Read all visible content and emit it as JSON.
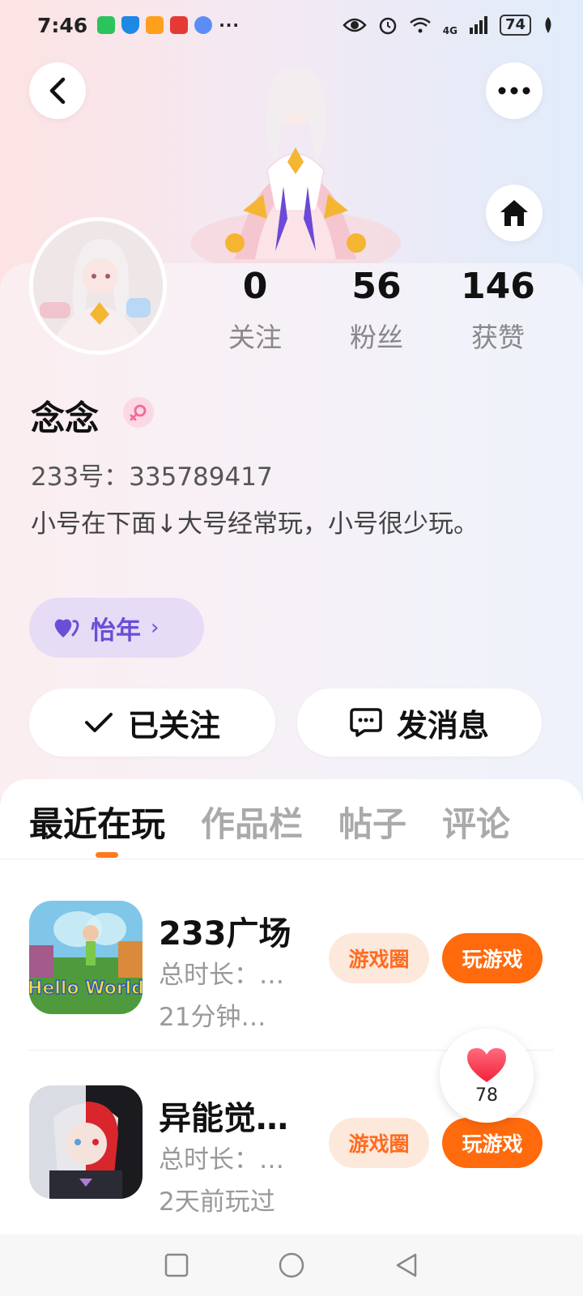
{
  "status_bar": {
    "time": "7:46",
    "more": "···",
    "network": "4G",
    "battery": "74"
  },
  "profile": {
    "nickname": "念念",
    "uid": "233号：335789417",
    "bio": "小号在下面↓大号经常玩，小号很少玩。",
    "tag": "怡年",
    "stats": [
      {
        "value": "0",
        "label": "关注"
      },
      {
        "value": "56",
        "label": "粉丝"
      },
      {
        "value": "146",
        "label": "获赞"
      }
    ],
    "follow_button": "已关注",
    "message_button": "发消息"
  },
  "tabs": [
    "最近在玩",
    "作品栏",
    "帖子",
    "评论"
  ],
  "games": [
    {
      "name": "233广场",
      "meta1": "总时长：…",
      "meta2": "21分钟…",
      "circle_button": "游戏圈",
      "play_button": "玩游戏",
      "icon_text": "Hello World"
    },
    {
      "name": "异能觉…",
      "meta1": "总时长：…",
      "meta2": "2天前玩过",
      "circle_button": "游戏圈",
      "play_button": "玩游戏"
    }
  ],
  "like_float": {
    "count": "78"
  },
  "colors": {
    "accent_orange": "#ff6a0d",
    "tag_purple": "#6a4fd6",
    "gender_pink": "#f06a9a"
  }
}
